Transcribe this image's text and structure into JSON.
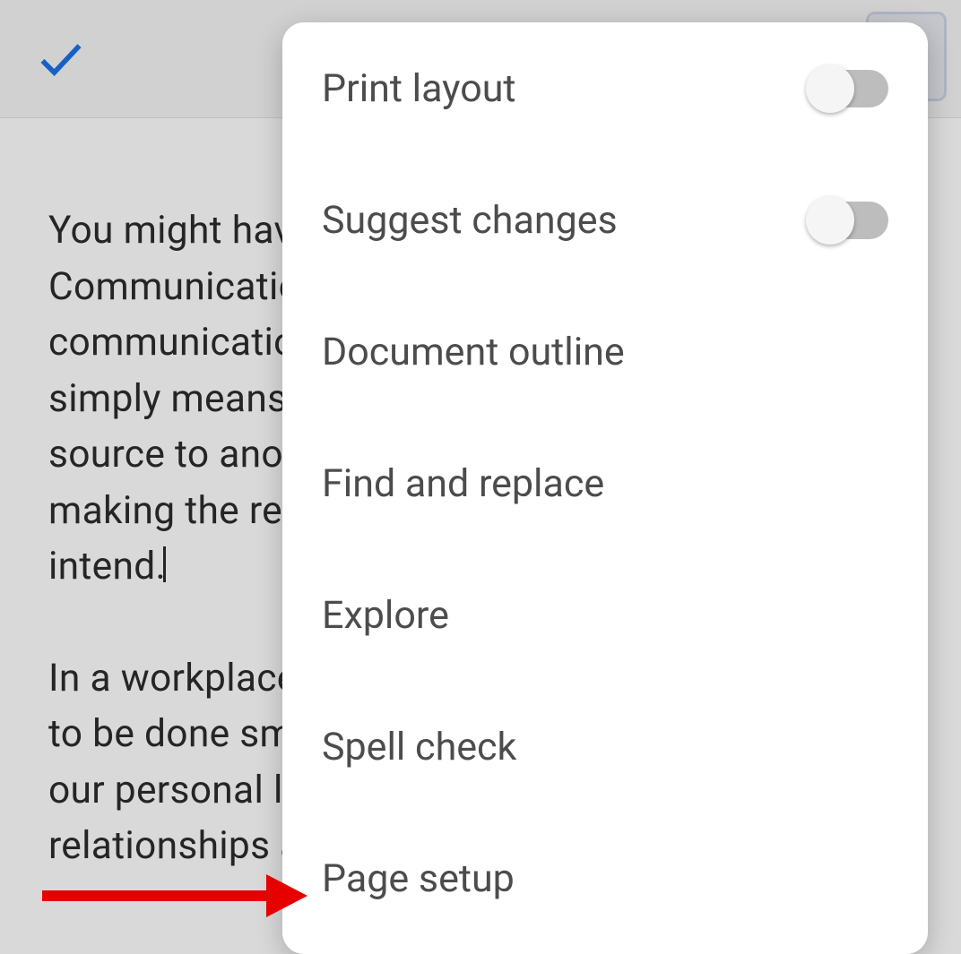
{
  "toolbar": {
    "confirm_icon": "check-icon"
  },
  "document": {
    "paragraph1": "You might have heard about this quite often - Communication is key. But what makes communication important? Communication simply means carrying information from one source to another. Communication is all about making the receiver understand the message you intend.",
    "paragraph2": "In a workplace, good communication allows work to be done smoothly and improves productivity. In our personal life, it helps to build strong relationships and it plays a vital role everywhere."
  },
  "menu": {
    "items": [
      {
        "label": "Print layout",
        "has_toggle": true,
        "toggle_on": false
      },
      {
        "label": "Suggest changes",
        "has_toggle": true,
        "toggle_on": false
      },
      {
        "label": "Document outline",
        "has_toggle": false
      },
      {
        "label": "Find and replace",
        "has_toggle": false
      },
      {
        "label": "Explore",
        "has_toggle": false
      },
      {
        "label": "Spell check",
        "has_toggle": false
      },
      {
        "label": "Page setup",
        "has_toggle": false
      }
    ]
  },
  "annotation": {
    "arrow_points_to": "Page setup"
  }
}
